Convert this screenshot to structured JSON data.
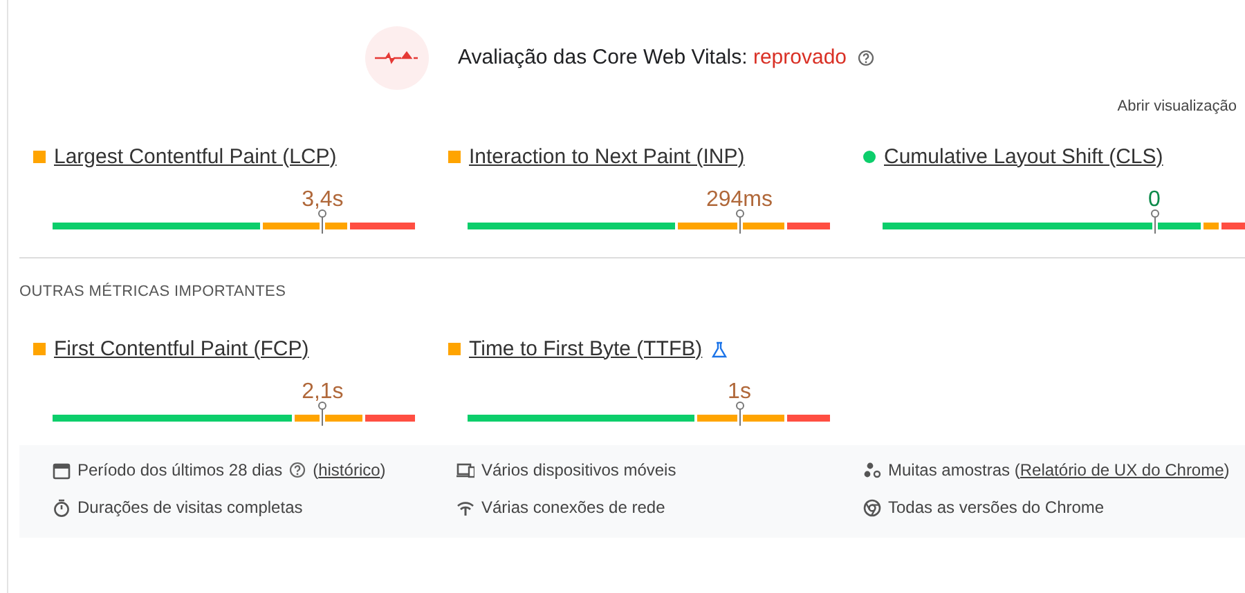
{
  "assessment": {
    "title": "Avaliação das Core Web Vitals:",
    "verdict": "reprovado",
    "kind": "failed"
  },
  "open_view": "Abrir visualização",
  "core_metrics": [
    {
      "name": "Largest Contentful Paint (LCP)",
      "value": "3,4s",
      "kind": "average",
      "experimental": false
    },
    {
      "name": "Interaction to Next Paint (INP)",
      "value": "294ms",
      "kind": "average",
      "experimental": false
    },
    {
      "name": "Cumulative Layout Shift (CLS)",
      "value": "0",
      "kind": "good",
      "experimental": false
    }
  ],
  "other_heading": "OUTRAS MÉTRICAS IMPORTANTES",
  "other_metrics": [
    {
      "name": "First Contentful Paint (FCP)",
      "value": "2,1s",
      "kind": "average",
      "experimental": false
    },
    {
      "name": "Time to First Byte (TTFB)",
      "value": "1s",
      "kind": "average",
      "experimental": true
    }
  ],
  "details": [
    {
      "text": "Período dos últimos 28 dias",
      "help": true,
      "aside": {
        "before": "(",
        "link": "histórico",
        "after": ")"
      }
    },
    {
      "text": "Vários dispositivos móveis",
      "help": false
    },
    {
      "text": "Muitas amostras",
      "help": false,
      "aside": {
        "before": "(",
        "link": "Relatório de UX do Chrome",
        "after": ")"
      }
    },
    {
      "text": "Durações de visitas completas",
      "help": false
    },
    {
      "text": "Várias conexões de rede",
      "help": false
    },
    {
      "text": "Todas as versões do Chrome",
      "help": false
    }
  ]
}
